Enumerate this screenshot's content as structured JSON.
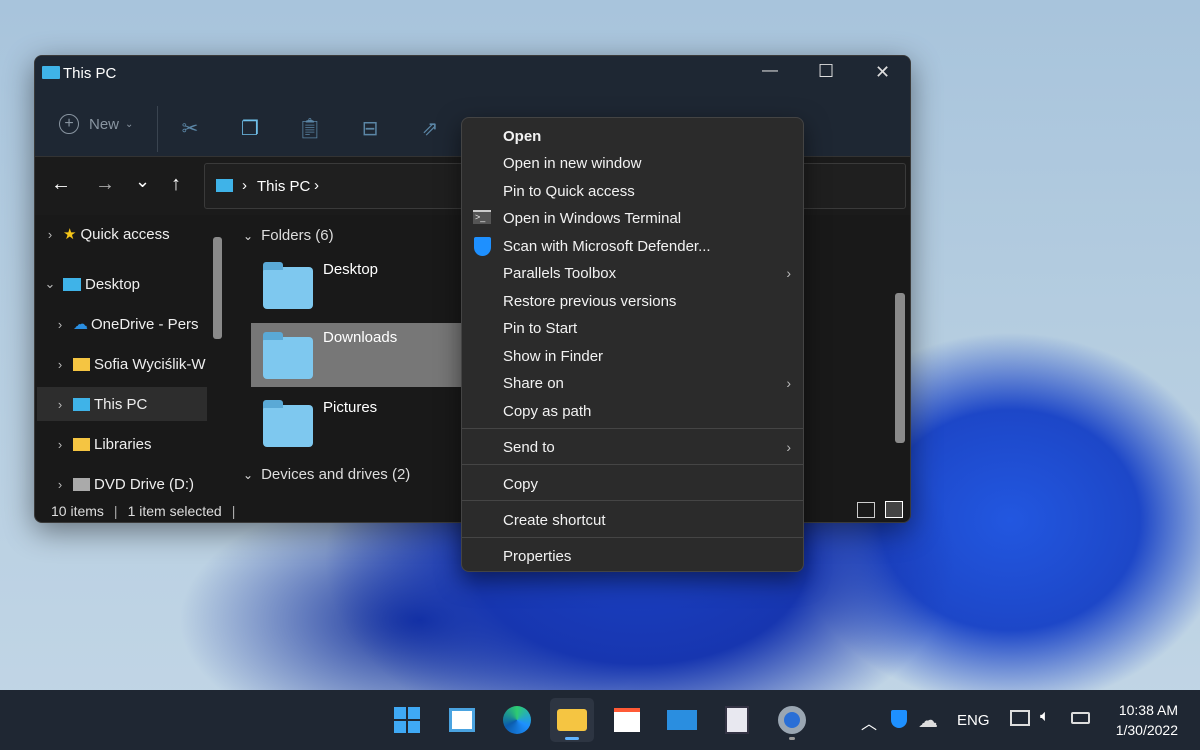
{
  "window": {
    "title": "This PC",
    "controls": {
      "minimize": "—",
      "maximize": "☐",
      "close": "✕"
    }
  },
  "toolbar": {
    "new_label": "New",
    "icons": [
      "cut-icon",
      "copy-icon",
      "paste-icon",
      "rename-icon",
      "share-icon"
    ]
  },
  "nav": {
    "path_sep": "›",
    "path": "This PC",
    "path_end": "›"
  },
  "sidebar": {
    "items": [
      {
        "label": "Quick access"
      },
      {
        "label": "Desktop"
      },
      {
        "label": "OneDrive - Pers"
      },
      {
        "label": "Sofia Wyciślik-W"
      },
      {
        "label": "This PC"
      },
      {
        "label": "Libraries"
      },
      {
        "label": "DVD Drive (D:)"
      }
    ]
  },
  "content": {
    "folders_header": "Folders (6)",
    "folders": [
      "Desktop",
      "Downloads",
      "Pictures"
    ],
    "devices_header": "Devices and drives (2)"
  },
  "status": {
    "items": "10 items",
    "selected": "1 item selected"
  },
  "context_menu": {
    "items": [
      "Open",
      "Open in new window",
      "Pin to Quick access",
      "Open in Windows Terminal",
      "Scan with Microsoft Defender...",
      "Parallels Toolbox",
      "Restore previous versions",
      "Pin to Start",
      "Show in Finder",
      "Share on",
      "Copy as path",
      "Send to",
      "Copy",
      "Create shortcut",
      "Properties"
    ]
  },
  "tray": {
    "language": "ENG",
    "time": "10:38 AM",
    "date": "1/30/2022"
  }
}
